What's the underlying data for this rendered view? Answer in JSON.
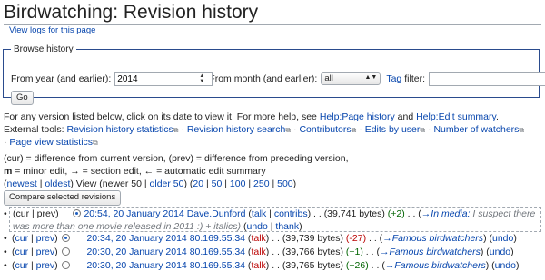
{
  "title": "Birdwatching: Revision history",
  "sub_link": "View logs for this page",
  "browse": {
    "legend": "Browse history",
    "year_label": "From year (and earlier):",
    "year_value": "2014",
    "month_label": "From month (and earlier):",
    "month_value": "all",
    "tag_label": "Tag",
    "filter_label": "filter:",
    "go": "Go"
  },
  "help": {
    "prefix": "For any version listed below, click on its date to view it. For more help, see ",
    "link1": "Help:Page history",
    "and": " and ",
    "link2": "Help:Edit summary",
    "end": "."
  },
  "ext_tools": {
    "label": "External tools:",
    "tools": [
      "Revision history statistics",
      "Revision history search",
      "Contributors",
      "Edits by user",
      "Number of watchers",
      "Page view statistics"
    ]
  },
  "legend": {
    "line1": "(cur) = difference from current version, (prev) = difference from preceding version,",
    "m": "m",
    "minor": " = minor edit, ",
    "arrow": "→",
    "section": " = section edit, ",
    "larrow": "←",
    "auto": " = automatic edit summary"
  },
  "nav": {
    "newest": "newest",
    "oldest": "oldest",
    "view": "View (newer 50 | ",
    "older": "older 50",
    "sizes": [
      "20",
      "50",
      "100",
      "250",
      "500"
    ]
  },
  "compare_button": "Compare selected revisions",
  "revisions": [
    {
      "cur": "cur",
      "prev": "prev",
      "time": "20:54, 20 January 2014",
      "user": "Dave.Dunford",
      "talk": "talk",
      "contribs": "contribs",
      "size": "(39,741 bytes)",
      "diff": "(+2)",
      "section": "→In media:",
      "summary": " I suspect there was more than one movie released in 2011 :) + italics)",
      "undo": "undo",
      "thank": "thank"
    },
    {
      "cur": "cur",
      "prev": "prev",
      "time": "20:34, 20 January 2014",
      "user": "80.169.55.34",
      "talk": "talk",
      "size": "(39,739 bytes)",
      "diff": "(-27)",
      "section": "→Famous birdwatchers",
      "undo": "undo"
    },
    {
      "cur": "cur",
      "prev": "prev",
      "time": "20:30, 20 January 2014",
      "user": "80.169.55.34",
      "talk": "talk",
      "size": "(39,766 bytes)",
      "diff": "(+1)",
      "section": "→Famous birdwatchers",
      "undo": "undo"
    },
    {
      "cur": "cur",
      "prev": "prev",
      "time": "20:30, 20 January 2014",
      "user": "80.169.55.34",
      "talk": "talk",
      "size": "(39,765 bytes)",
      "diff": "(+26)",
      "section": "→Famous birdwatchers",
      "undo": "undo"
    }
  ]
}
